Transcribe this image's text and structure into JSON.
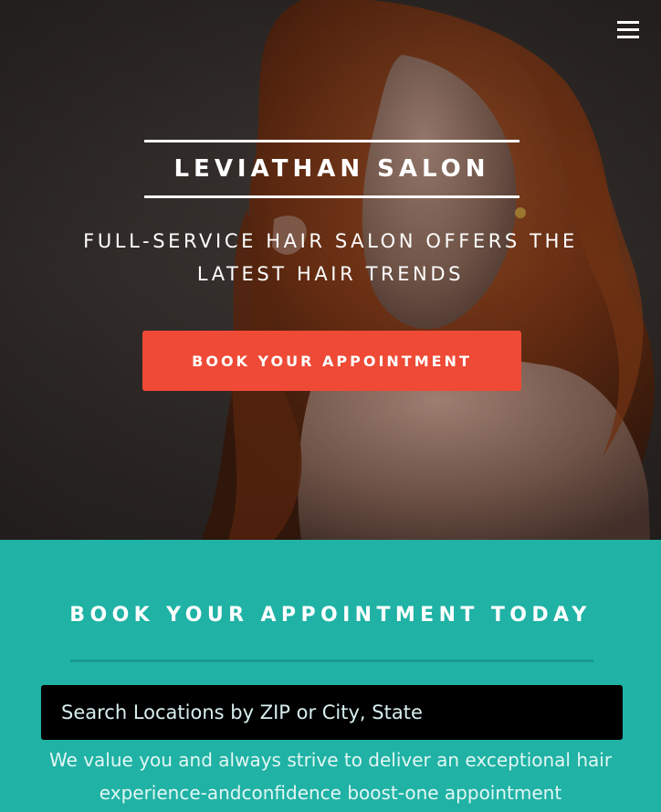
{
  "hero": {
    "brand": "LEVIATHAN SALON",
    "tagline": "FULL-SERVICE HAIR SALON OFFERS THE LATEST HAIR TRENDS",
    "cta_label": "BOOK YOUR APPOINTMENT",
    "menu_icon": "hamburger-menu-icon",
    "photo": "portrait of a woman with long wavy red hair"
  },
  "booking": {
    "title": "BOOK YOUR APPOINTMENT TODAY",
    "search_placeholder": "Search Locations by ZIP or City, State",
    "intro": "We value you and always strive to deliver an exceptional hair experience-andconfidence boost-one appointment"
  },
  "colors": {
    "accent_button": "#ee4a36",
    "section_teal": "#1fb2a5",
    "divider_teal": "#179a8f",
    "search_bg": "#000000"
  }
}
